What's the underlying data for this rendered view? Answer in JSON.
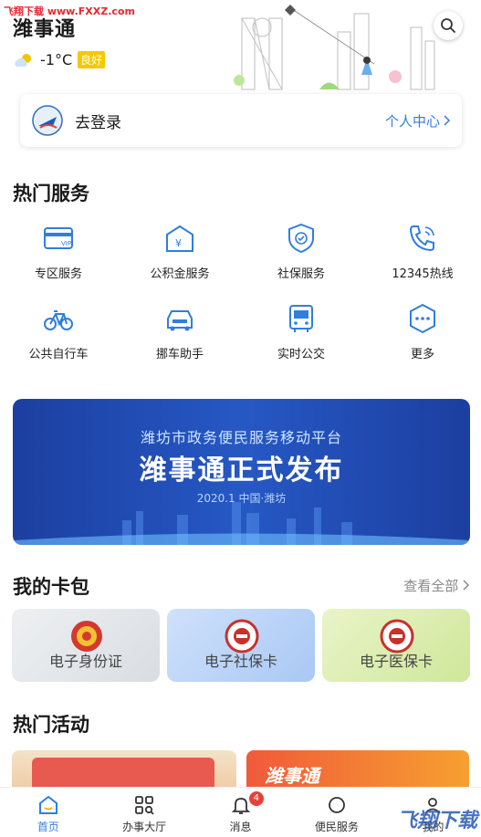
{
  "watermark_top": "飞翔下载 www.FXXZ.com",
  "watermark_bottom": "飞翔下载",
  "header": {
    "app_title": "潍事通",
    "weather_temp": "-1°C",
    "air_quality": "良好"
  },
  "login": {
    "label": "去登录",
    "personal_center": "个人中心"
  },
  "hot_services": {
    "title": "热门服务",
    "items": [
      {
        "label": "专区服务",
        "icon": "vip-card-icon"
      },
      {
        "label": "公积金服务",
        "icon": "fund-box-icon"
      },
      {
        "label": "社保服务",
        "icon": "shield-icon"
      },
      {
        "label": "12345热线",
        "icon": "phone-icon"
      },
      {
        "label": "公共自行车",
        "icon": "bicycle-icon"
      },
      {
        "label": "挪车助手",
        "icon": "car-icon"
      },
      {
        "label": "实时公交",
        "icon": "bus-icon"
      },
      {
        "label": "更多",
        "icon": "more-icon"
      }
    ]
  },
  "banner": {
    "subtitle": "潍坊市政务便民服务移动平台",
    "title": "潍事通正式发布",
    "date": "2020.1 中国·潍坊"
  },
  "wallet": {
    "title": "我的卡包",
    "view_all": "查看全部",
    "cards": [
      {
        "label": "电子身份证"
      },
      {
        "label": "电子社保卡"
      },
      {
        "label": "电子医保卡"
      }
    ]
  },
  "activities": {
    "title": "热门活动",
    "banner2_text": "潍事通"
  },
  "tabbar": {
    "tabs": [
      {
        "label": "首页"
      },
      {
        "label": "办事大厅"
      },
      {
        "label": "消息"
      },
      {
        "label": "便民服务"
      },
      {
        "label": "我的"
      }
    ],
    "message_badge": "4"
  }
}
